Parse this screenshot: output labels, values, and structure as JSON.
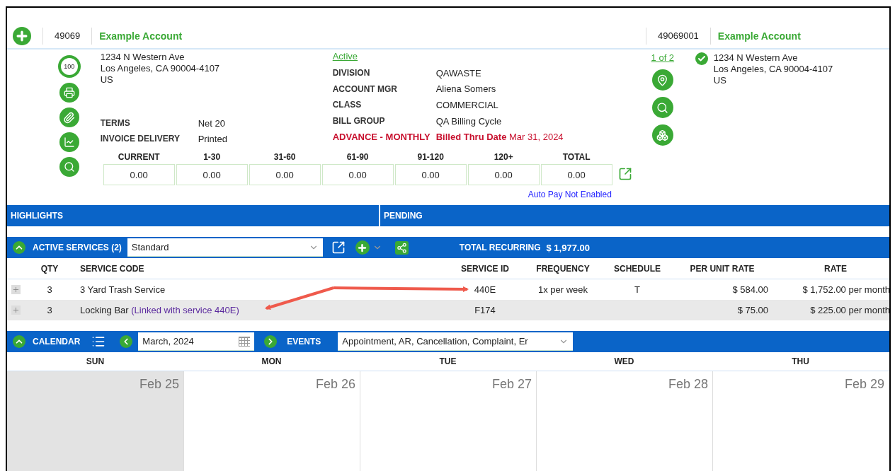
{
  "header": {
    "account_number": "49069",
    "account_name": "Example Account",
    "site_number": "49069001",
    "site_name": "Example Account"
  },
  "account": {
    "score": "100",
    "address": [
      "1234 N Western Ave",
      "Los Angeles, CA 90004-4107",
      "US"
    ],
    "terms": [
      {
        "label": "TERMS",
        "value": "Net 20"
      },
      {
        "label": "INVOICE DELIVERY",
        "value": "Printed"
      }
    ],
    "status": "Active",
    "details": [
      {
        "label": "DIVISION",
        "value": "QAWASTE"
      },
      {
        "label": "ACCOUNT MGR",
        "value": "Aliena Somers"
      },
      {
        "label": "CLASS",
        "value": "COMMERCIAL"
      },
      {
        "label": "BILL GROUP",
        "value": "QA Billing Cycle"
      }
    ],
    "billing": {
      "cycle": "ADVANCE - MONTHLY",
      "billed_thru": "**Billed Thru Date** Mar 31, 2024"
    },
    "aging": [
      {
        "label": "CURRENT",
        "value": "0.00"
      },
      {
        "label": "1-30",
        "value": "0.00"
      },
      {
        "label": "31-60",
        "value": "0.00"
      },
      {
        "label": "61-90",
        "value": "0.00"
      },
      {
        "label": "91-120",
        "value": "0.00"
      },
      {
        "label": "120+",
        "value": "0.00"
      },
      {
        "label": "TOTAL",
        "value": "0.00"
      }
    ],
    "autopay": "Auto Pay Not Enabled"
  },
  "site": {
    "pager": "1 of 2",
    "verified": true,
    "address": [
      "1234 N Western Ave",
      "Los Angeles, CA 90004-4107",
      "US"
    ]
  },
  "panels": [
    "HIGHLIGHTS",
    "PENDING"
  ],
  "services": {
    "expanded": true,
    "title": "ACTIVE SERVICES (2)",
    "view": "Standard",
    "total_label": "TOTAL RECURRING",
    "total_value": "$ 1,977.00",
    "columns": [
      "QTY",
      "SERVICE CODE",
      "SERVICE ID",
      "FREQUENCY",
      "SCHEDULE",
      "PER UNIT RATE",
      "RATE"
    ],
    "rows": [
      {
        "qty": "3",
        "code": "3 Yard Trash Service",
        "service_id": "440E",
        "frequency": "1x per week",
        "schedule": "T",
        "per_unit_rate": "$ 584.00",
        "rate": "$ 1,752.00 per month"
      },
      {
        "qty": "3",
        "code": "Locking Bar",
        "note": "(Linked with service 440E)",
        "service_id": "F174",
        "per_unit_rate": "$ 75.00",
        "rate": "$ 225.00 per month"
      }
    ]
  },
  "calendar": {
    "expanded": true,
    "title": "CALENDAR",
    "month": "March, 2024",
    "events_label": "EVENTS",
    "events": "Appointment, AR, Cancellation, Complaint, Er",
    "days": [
      {
        "name": "SUN",
        "date": "Feb 25",
        "shaded": true
      },
      {
        "name": "MON",
        "date": "Feb 26",
        "shaded": false
      },
      {
        "name": "TUE",
        "date": "Feb 27",
        "shaded": false
      },
      {
        "name": "WED",
        "date": "Feb 28",
        "shaded": false
      },
      {
        "name": "THU",
        "date": "Feb 29",
        "shaded": false
      }
    ]
  }
}
